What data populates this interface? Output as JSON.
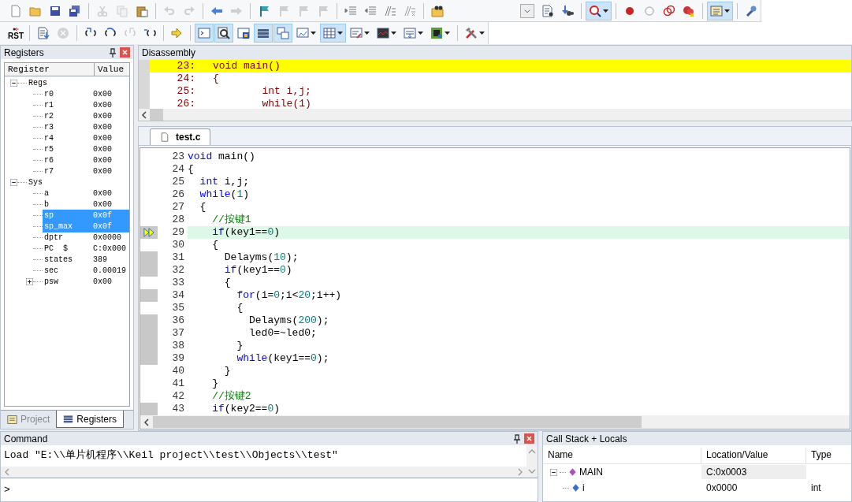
{
  "toolbar_1": [
    {
      "kind": "button",
      "on": false,
      "disabled": false,
      "dropdown": false
    },
    {
      "kind": "button",
      "on": false,
      "disabled": false,
      "dropdown": false
    },
    {
      "kind": "button",
      "on": false,
      "disabled": false,
      "dropdown": false
    },
    {
      "kind": "button",
      "on": false,
      "disabled": false,
      "dropdown": false
    },
    {
      "kind": "separator"
    },
    {
      "kind": "button",
      "on": false,
      "disabled": true,
      "dropdown": false
    },
    {
      "kind": "button",
      "on": false,
      "disabled": true,
      "dropdown": false
    },
    {
      "kind": "button",
      "on": false,
      "disabled": false,
      "dropdown": false
    },
    {
      "kind": "separator"
    },
    {
      "kind": "button",
      "on": false,
      "disabled": true,
      "dropdown": false
    },
    {
      "kind": "button",
      "on": false,
      "disabled": true,
      "dropdown": false
    },
    {
      "kind": "separator"
    },
    {
      "kind": "button",
      "on": false,
      "disabled": false,
      "dropdown": false
    },
    {
      "kind": "button",
      "on": false,
      "disabled": true,
      "dropdown": false
    },
    {
      "kind": "separator"
    },
    {
      "kind": "button",
      "on": false,
      "disabled": false,
      "dropdown": false
    },
    {
      "kind": "button",
      "on": false,
      "disabled": true,
      "dropdown": false
    },
    {
      "kind": "button",
      "on": false,
      "disabled": true,
      "dropdown": false
    },
    {
      "kind": "button",
      "on": false,
      "disabled": true,
      "dropdown": false
    },
    {
      "kind": "separator"
    },
    {
      "kind": "button",
      "on": false,
      "disabled": false,
      "dropdown": false
    },
    {
      "kind": "button",
      "on": false,
      "disabled": false,
      "dropdown": false
    },
    {
      "kind": "button",
      "on": false,
      "disabled": false,
      "dropdown": false
    },
    {
      "kind": "button",
      "on": false,
      "disabled": false,
      "dropdown": false
    },
    {
      "kind": "separator"
    },
    {
      "kind": "button",
      "on": false,
      "disabled": false,
      "dropdown": false
    },
    {
      "kind": "spacer"
    },
    {
      "kind": "combo"
    },
    {
      "kind": "button",
      "on": false,
      "disabled": false,
      "dropdown": false
    },
    {
      "kind": "button",
      "on": false,
      "disabled": false,
      "dropdown": false
    },
    {
      "kind": "separator"
    },
    {
      "kind": "button",
      "on": true,
      "disabled": false,
      "dropdown": true
    },
    {
      "kind": "separator"
    },
    {
      "kind": "button",
      "on": false,
      "disabled": false,
      "dropdown": false
    },
    {
      "kind": "button",
      "on": false,
      "disabled": false,
      "dropdown": false
    },
    {
      "kind": "button",
      "on": false,
      "disabled": false,
      "dropdown": false
    },
    {
      "kind": "button",
      "on": false,
      "disabled": false,
      "dropdown": false
    },
    {
      "kind": "separator"
    },
    {
      "kind": "button",
      "on": true,
      "disabled": false,
      "dropdown": true
    },
    {
      "kind": "separator"
    },
    {
      "kind": "button",
      "on": false,
      "disabled": false,
      "dropdown": false
    }
  ],
  "toolbar_2": [
    {
      "kind": "reset",
      "label": "RST"
    },
    {
      "kind": "separator"
    },
    {
      "kind": "button",
      "on": false,
      "disabled": false,
      "dropdown": false
    },
    {
      "kind": "button",
      "on": false,
      "disabled": true,
      "dropdown": false
    },
    {
      "kind": "separator"
    },
    {
      "kind": "button",
      "on": false,
      "disabled": false,
      "dropdown": false
    },
    {
      "kind": "button",
      "on": false,
      "disabled": false,
      "dropdown": false
    },
    {
      "kind": "button",
      "on": false,
      "disabled": true,
      "dropdown": false
    },
    {
      "kind": "button",
      "on": false,
      "disabled": false,
      "dropdown": false
    },
    {
      "kind": "separator"
    },
    {
      "kind": "button",
      "on": false,
      "disabled": false,
      "dropdown": false
    },
    {
      "kind": "separator"
    },
    {
      "kind": "button",
      "on": true,
      "disabled": false,
      "dropdown": false
    },
    {
      "kind": "button",
      "on": true,
      "disabled": false,
      "dropdown": false
    },
    {
      "kind": "button",
      "on": false,
      "disabled": false,
      "dropdown": false
    },
    {
      "kind": "button",
      "on": true,
      "disabled": false,
      "dropdown": false
    },
    {
      "kind": "button",
      "on": true,
      "disabled": false,
      "dropdown": false
    },
    {
      "kind": "button",
      "on": false,
      "disabled": false,
      "dropdown": true
    },
    {
      "kind": "button",
      "on": true,
      "disabled": false,
      "dropdown": true
    },
    {
      "kind": "button",
      "on": false,
      "disabled": false,
      "dropdown": true
    },
    {
      "kind": "button",
      "on": false,
      "disabled": false,
      "dropdown": true
    },
    {
      "kind": "button",
      "on": false,
      "disabled": false,
      "dropdown": true
    },
    {
      "kind": "button",
      "on": false,
      "disabled": false,
      "dropdown": true
    },
    {
      "kind": "separator"
    },
    {
      "kind": "button",
      "on": false,
      "disabled": false,
      "dropdown": true
    }
  ],
  "registers": {
    "title": "Registers",
    "columns": [
      "Register",
      "Value"
    ],
    "tree": [
      {
        "name": "Regs",
        "expanded": true,
        "children": [
          {
            "name": "r0",
            "value": "0x00",
            "selected": false
          },
          {
            "name": "r1",
            "value": "0x00",
            "selected": false
          },
          {
            "name": "r2",
            "value": "0x00",
            "selected": false
          },
          {
            "name": "r3",
            "value": "0x00",
            "selected": false
          },
          {
            "name": "r4",
            "value": "0x00",
            "selected": false
          },
          {
            "name": "r5",
            "value": "0x00",
            "selected": false
          },
          {
            "name": "r6",
            "value": "0x00",
            "selected": false
          },
          {
            "name": "r7",
            "value": "0x00",
            "selected": false
          }
        ]
      },
      {
        "name": "Sys",
        "expanded": true,
        "children": [
          {
            "name": "a",
            "value": "0x00",
            "selected": false
          },
          {
            "name": "b",
            "value": "0x00",
            "selected": false
          },
          {
            "name": "sp",
            "value": "0x0f",
            "selected": true
          },
          {
            "name": "sp_max",
            "value": "0x0f",
            "selected": true
          },
          {
            "name": "dptr",
            "value": "0x0000",
            "selected": false
          },
          {
            "name": "PC  $",
            "value": "C:0x000",
            "selected": false
          },
          {
            "name": "states",
            "value": "389",
            "selected": false
          },
          {
            "name": "sec",
            "value": "0.00019",
            "selected": false
          },
          {
            "name": "psw",
            "value": "0x00",
            "selected": false,
            "expanded": false
          }
        ]
      }
    ],
    "tabs": [
      {
        "label": "Project",
        "selected": false
      },
      {
        "label": "Registers",
        "selected": true
      }
    ]
  },
  "disassembly": {
    "title": "Disassembly",
    "lines": [
      {
        "num": "23:",
        "code": "void main()",
        "selected": true
      },
      {
        "num": "24:",
        "code": "{",
        "selected": false
      },
      {
        "num": "25:",
        "code": "        int i,j;",
        "selected": false
      },
      {
        "num": "26:",
        "code": "        while(1)",
        "selected": false
      }
    ]
  },
  "editor": {
    "tabs": [
      {
        "label": "test.c",
        "selected": true
      }
    ],
    "lines": [
      {
        "n": "23",
        "executable": false,
        "current": false,
        "tokens": [
          {
            "kind": "keyword",
            "text": "void"
          },
          {
            "kind": "text",
            "text": " main()"
          }
        ]
      },
      {
        "n": "24",
        "executable": false,
        "current": false,
        "tokens": [
          {
            "kind": "text",
            "text": "{"
          }
        ]
      },
      {
        "n": "25",
        "executable": false,
        "current": false,
        "tokens": [
          {
            "kind": "keyword",
            "text": "  int"
          },
          {
            "kind": "text",
            "text": " i,j;"
          }
        ]
      },
      {
        "n": "26",
        "executable": false,
        "current": false,
        "tokens": [
          {
            "kind": "keyword",
            "text": "  while"
          },
          {
            "kind": "text",
            "text": "("
          },
          {
            "kind": "number",
            "text": "1"
          },
          {
            "kind": "text",
            "text": ")"
          }
        ]
      },
      {
        "n": "27",
        "executable": false,
        "current": false,
        "tokens": [
          {
            "kind": "text",
            "text": "  {"
          }
        ]
      },
      {
        "n": "28",
        "executable": false,
        "current": false,
        "tokens": [
          {
            "kind": "comment",
            "text": "    //按键1"
          }
        ]
      },
      {
        "n": "29",
        "executable": true,
        "current": true,
        "tokens": [
          {
            "kind": "keyword",
            "text": "    if"
          },
          {
            "kind": "text",
            "text": "(key1=="
          },
          {
            "kind": "number",
            "text": "0"
          },
          {
            "kind": "text",
            "text": ")"
          }
        ]
      },
      {
        "n": "30",
        "executable": false,
        "current": false,
        "tokens": [
          {
            "kind": "text",
            "text": "    {"
          }
        ]
      },
      {
        "n": "31",
        "executable": true,
        "current": false,
        "tokens": [
          {
            "kind": "text",
            "text": "      Delayms("
          },
          {
            "kind": "number",
            "text": "10"
          },
          {
            "kind": "text",
            "text": ");"
          }
        ]
      },
      {
        "n": "32",
        "executable": true,
        "current": false,
        "tokens": [
          {
            "kind": "keyword",
            "text": "      if"
          },
          {
            "kind": "text",
            "text": "(key1=="
          },
          {
            "kind": "number",
            "text": "0"
          },
          {
            "kind": "text",
            "text": ")"
          }
        ]
      },
      {
        "n": "33",
        "executable": false,
        "current": false,
        "tokens": [
          {
            "kind": "text",
            "text": "      {"
          }
        ]
      },
      {
        "n": "34",
        "executable": true,
        "current": false,
        "tokens": [
          {
            "kind": "keyword",
            "text": "        for"
          },
          {
            "kind": "text",
            "text": "(i="
          },
          {
            "kind": "number",
            "text": "0"
          },
          {
            "kind": "text",
            "text": ";i<"
          },
          {
            "kind": "number",
            "text": "20"
          },
          {
            "kind": "text",
            "text": ";i++)"
          }
        ]
      },
      {
        "n": "35",
        "executable": false,
        "current": false,
        "tokens": [
          {
            "kind": "text",
            "text": "        {"
          }
        ]
      },
      {
        "n": "36",
        "executable": true,
        "current": false,
        "tokens": [
          {
            "kind": "text",
            "text": "          Delayms("
          },
          {
            "kind": "number",
            "text": "200"
          },
          {
            "kind": "text",
            "text": ");"
          }
        ]
      },
      {
        "n": "37",
        "executable": true,
        "current": false,
        "tokens": [
          {
            "kind": "text",
            "text": "          led0=~led0;"
          }
        ]
      },
      {
        "n": "38",
        "executable": true,
        "current": false,
        "tokens": [
          {
            "kind": "text",
            "text": "        }"
          }
        ]
      },
      {
        "n": "39",
        "executable": true,
        "current": false,
        "tokens": [
          {
            "kind": "keyword",
            "text": "        while"
          },
          {
            "kind": "text",
            "text": "(key1=="
          },
          {
            "kind": "number",
            "text": "0"
          },
          {
            "kind": "text",
            "text": ");"
          }
        ]
      },
      {
        "n": "40",
        "executable": false,
        "current": false,
        "tokens": [
          {
            "kind": "text",
            "text": "      }"
          }
        ]
      },
      {
        "n": "41",
        "executable": false,
        "current": false,
        "tokens": [
          {
            "kind": "text",
            "text": "    }"
          }
        ]
      },
      {
        "n": "42",
        "executable": false,
        "current": false,
        "tokens": [
          {
            "kind": "comment",
            "text": "    //按键2"
          }
        ]
      },
      {
        "n": "43",
        "executable": true,
        "current": false,
        "tokens": [
          {
            "kind": "keyword",
            "text": "    if"
          },
          {
            "kind": "text",
            "text": "(key2=="
          },
          {
            "kind": "number",
            "text": "0"
          },
          {
            "kind": "text",
            "text": ")"
          }
        ]
      }
    ]
  },
  "command": {
    "title": "Command",
    "output": "Load \"E:\\\\单片机程序\\\\Keil project\\\\test\\\\Objects\\\\test\"",
    "prompt": ">"
  },
  "call_stack": {
    "title": "Call Stack + Locals",
    "columns": [
      "Name",
      "Location/Value",
      "Type"
    ],
    "rows": [
      {
        "name": "MAIN",
        "value": "C:0x0003",
        "expanded": true,
        "children": [
          {
            "name": "i",
            "value": "0x0000",
            "type": "int"
          }
        ]
      }
    ]
  }
}
